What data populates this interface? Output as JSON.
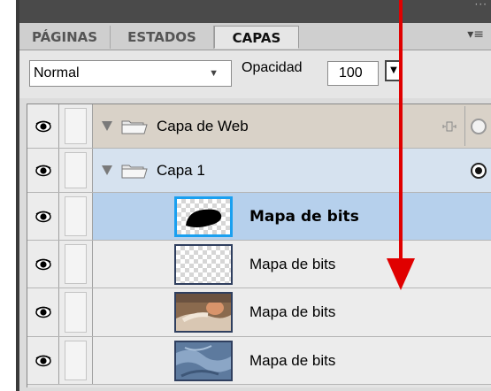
{
  "tabs": [
    {
      "label": "PÁGINAS",
      "active": false
    },
    {
      "label": "ESTADOS",
      "active": false
    },
    {
      "label": "CAPAS",
      "active": true
    }
  ],
  "controls": {
    "blend_mode": "Normal",
    "opacity_label": "Opacidad",
    "opacity_value": "100"
  },
  "layers": [
    {
      "name": "Capa de Web",
      "type": "folder",
      "expanded": true,
      "visible": true
    },
    {
      "name": "Capa 1",
      "type": "folder",
      "expanded": true,
      "visible": true,
      "current": true
    },
    {
      "name": "Mapa de bits",
      "type": "bitmap",
      "selected": true,
      "visible": true,
      "thumb": "black-shape"
    },
    {
      "name": "Mapa de bits",
      "type": "bitmap",
      "visible": true,
      "thumb": "empty-checker"
    },
    {
      "name": "Mapa de bits",
      "type": "bitmap",
      "visible": true,
      "thumb": "baby-photo"
    },
    {
      "name": "Mapa de bits",
      "type": "bitmap",
      "visible": true,
      "thumb": "fabric-photo"
    }
  ],
  "colors": {
    "selection": "#b6d0ec",
    "accent_arrow": "#e00000",
    "thumb_selected_border": "#1aa0f0"
  }
}
